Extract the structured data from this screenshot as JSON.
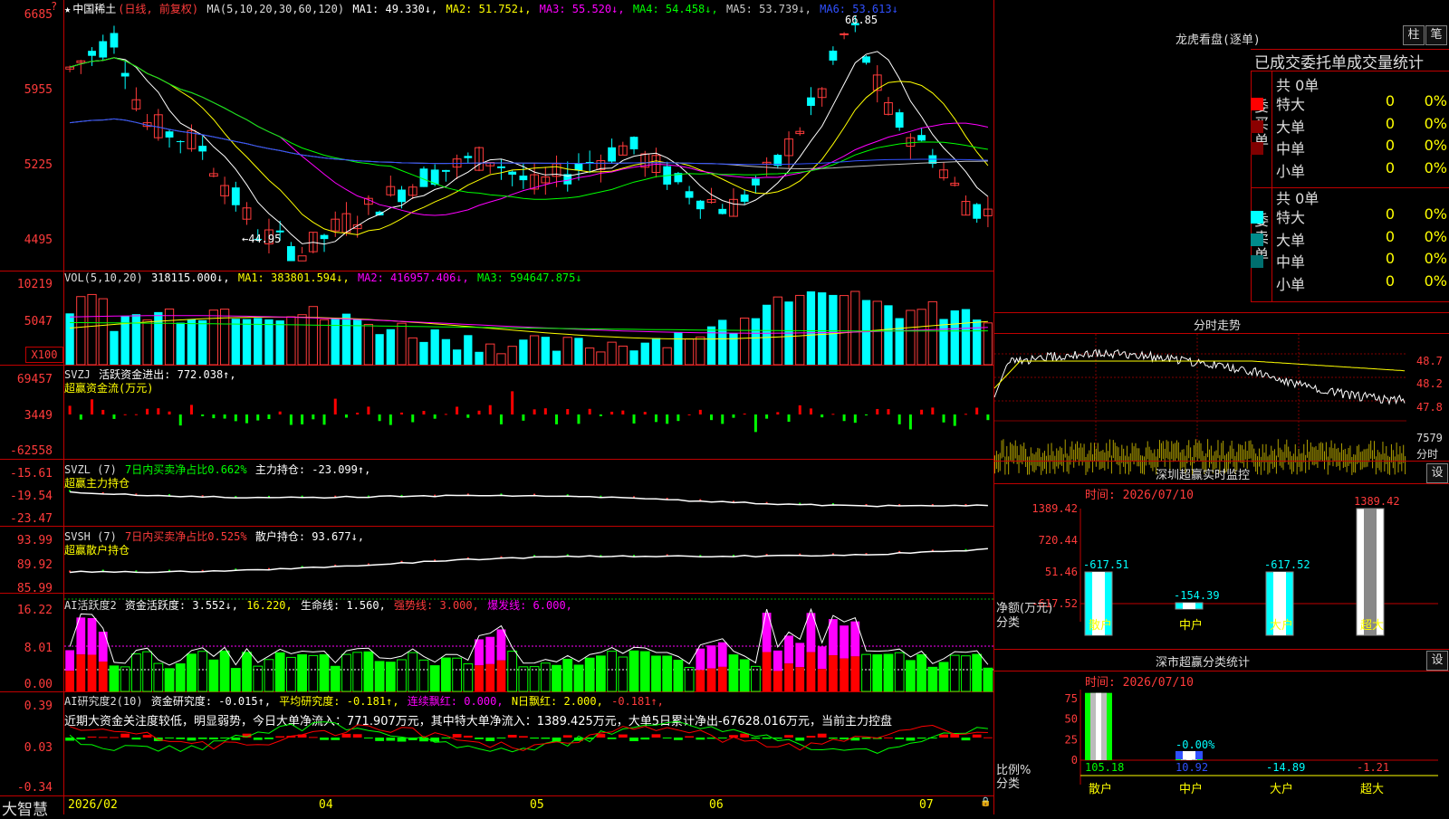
{
  "main": {
    "title_star": "★",
    "stock_name": "中国稀土",
    "mode": "(日线, 前复权)",
    "ma_label": "MA(5,10,20,30,60,120)",
    "ma1": "MA1: 49.330↓,",
    "ma2": "MA2: 51.752↓,",
    "ma3": "MA3: 55.520↓,",
    "ma4": "MA4: 54.458↓,",
    "ma5": "MA5: 53.739↓,",
    "ma6": "MA6: 53.613↓",
    "y_ticks": [
      "6685",
      "5955",
      "5225",
      "4495"
    ],
    "hi_label": "66.85",
    "lo_label": "←44.95",
    "question_mark": "?"
  },
  "vol": {
    "label": "VOL(5,10,20)",
    "value": "318115.000↓,",
    "ma1": "MA1: 383801.594↓,",
    "ma2": "MA2: 416957.406↓,",
    "ma3": "MA3: 594647.875↓",
    "y_ticks": [
      "10219",
      "5047"
    ],
    "unit": "X100"
  },
  "svzj": {
    "label": "SVZJ",
    "text": "活跃资金进出: 772.038↑,",
    "subtitle": "超赢资金流(万元)",
    "y_ticks": [
      "69457",
      "3449",
      "-62558"
    ]
  },
  "svzl": {
    "label": "SVZL (7)",
    "pct": "7日内买卖净占比0.662%",
    "text": "主力持仓: -23.099↑,",
    "subtitle": "超赢主力持仓",
    "y_ticks": [
      "-15.61",
      "-19.54",
      "-23.47"
    ]
  },
  "svsh": {
    "label": "SVSH (7)",
    "pct": "7日内买卖净占比0.525%",
    "text": "散户持仓: 93.677↓,",
    "subtitle": "超赢散户持仓",
    "y_ticks": [
      "93.99",
      "89.92",
      "85.99"
    ]
  },
  "ai_act": {
    "label": "AI活跃度2",
    "t1": "资金活跃度: 3.552↓,",
    "t2": "16.220,",
    "t3": "生命线: 1.560,",
    "t4": "强势线: 3.000,",
    "t5": "爆发线: 6.000,",
    "y_ticks": [
      "16.22",
      "8.01",
      "0.00"
    ]
  },
  "ai_res": {
    "label": "AI研究度2(10)",
    "t1": "资金研究度: -0.015↑,",
    "t2": "平均研究度: -0.181↑,",
    "t3": "连续飘红: 0.000,",
    "t4": "N日飘红: 2.000,",
    "t5": "-0.181↑,",
    "comment": "近期大资金关注度较低，明显弱势，今日大单净流入：771.907万元，其中特大单净流入：1389.425万元，大单5日累计净出-67628.016万元，当前主力控盘",
    "y_ticks": [
      "0.39",
      "0.03",
      "-0.34"
    ]
  },
  "bottom": {
    "brand": "大智慧",
    "dates": [
      "2026/02",
      "04",
      "05",
      "06",
      "07"
    ],
    "lock": "🔒"
  },
  "lhkp": {
    "title": "龙虎看盘(逐单)",
    "btn_zhu": "柱",
    "btn_bi": "笔",
    "header": "已成交委托单成交量统计",
    "buy_label": [
      "委",
      "买",
      "单"
    ],
    "sell_label": [
      "委",
      "卖",
      "单"
    ],
    "buy_total": "共 0单",
    "sell_total": "共 0单",
    "buy_rows": [
      {
        "name": "特大",
        "count": "0",
        "pct": "0%",
        "color": "#ff0000"
      },
      {
        "name": "大单",
        "count": "0",
        "pct": "0%",
        "color": "#8b0000"
      },
      {
        "name": "中单",
        "count": "0",
        "pct": "0%",
        "color": "#800000"
      },
      {
        "name": "小单",
        "count": "0",
        "pct": "0%",
        "color": ""
      }
    ],
    "sell_rows": [
      {
        "name": "特大",
        "count": "0",
        "pct": "0%",
        "color": "#00ffff"
      },
      {
        "name": "大单",
        "count": "0",
        "pct": "0%",
        "color": "#008b8b"
      },
      {
        "name": "中单",
        "count": "0",
        "pct": "0%",
        "color": "#006e6e"
      },
      {
        "name": "小单",
        "count": "0",
        "pct": "0%",
        "color": ""
      }
    ]
  },
  "intraday": {
    "title": "分时走势",
    "y_ticks": [
      "48.7",
      "48.2",
      "47.8"
    ],
    "vol_ticks": [
      "7579",
      "分时"
    ]
  },
  "sz_monitor": {
    "title": "深圳超赢实时监控",
    "settings": "设",
    "time": "时间: 2026/07/10",
    "y_ticks": [
      "1389.42",
      "720.44",
      "51.46",
      "-617.52"
    ],
    "y_title": "净额(万元)",
    "x_title": "分类",
    "categories": [
      "散户",
      "中户",
      "大户",
      "超大"
    ],
    "values": [
      -617.51,
      -154.39,
      -617.52,
      1389.42
    ],
    "value_labels": [
      "-617.51",
      "-154.39",
      "-617.52",
      "1389.42"
    ]
  },
  "sz_class": {
    "title": "深市超赢分类统计",
    "settings": "设",
    "time": "时间: 2026/07/10",
    "y_ticks": [
      "75",
      "50",
      "25",
      "0"
    ],
    "y_title": "比例%",
    "x_title": "分类",
    "categories": [
      "散户",
      "中户",
      "大户",
      "超大"
    ],
    "values": [
      105.18,
      10.92,
      -14.89,
      -1.21
    ],
    "value_labels": [
      "105.18",
      "10.92",
      "-14.89",
      "-1.21"
    ],
    "note": "-0.00%"
  },
  "chart_data": [
    {
      "type": "candlestick",
      "title": "中国稀土 (日线, 前复权)",
      "ylim": [
        44.95,
        66.85
      ],
      "high": 66.85,
      "low": 44.95,
      "close_last": 48.2,
      "x_date_labels": [
        "2026/02",
        "04",
        "05",
        "06",
        "07"
      ]
    },
    {
      "type": "bar",
      "title": "深圳超赢实时监控",
      "categories": [
        "散户",
        "中户",
        "大户",
        "超大"
      ],
      "values": [
        -617.51,
        -154.39,
        -617.52,
        1389.42
      ],
      "ylabel": "净额(万元)",
      "ylim": [
        -617.52,
        1389.42
      ]
    },
    {
      "type": "bar",
      "title": "深市超赢分类统计",
      "categories": [
        "散户",
        "中户",
        "大户",
        "超大"
      ],
      "values": [
        105.18,
        10.92,
        -14.89,
        -1.21
      ],
      "ylabel": "比例%",
      "ylim": [
        0,
        75
      ]
    }
  ]
}
